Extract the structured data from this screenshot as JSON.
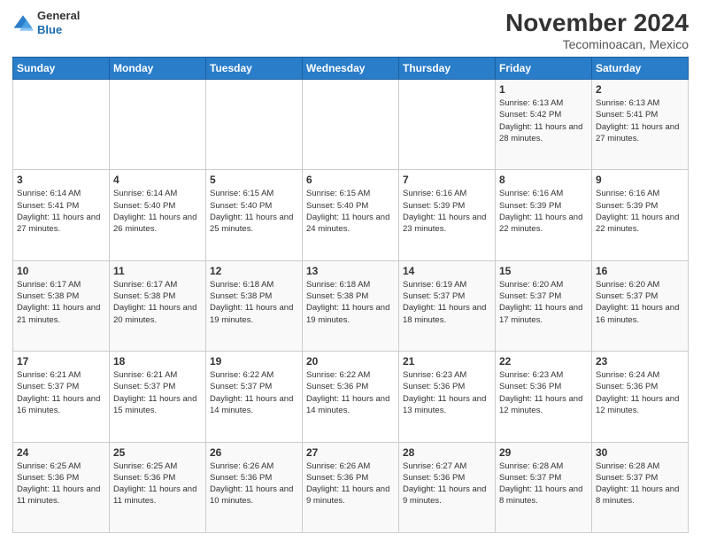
{
  "header": {
    "logo": {
      "general": "General",
      "blue": "Blue"
    },
    "month": "November 2024",
    "location": "Tecominoacan, Mexico"
  },
  "weekdays": [
    "Sunday",
    "Monday",
    "Tuesday",
    "Wednesday",
    "Thursday",
    "Friday",
    "Saturday"
  ],
  "weeks": [
    [
      {
        "date": "",
        "info": ""
      },
      {
        "date": "",
        "info": ""
      },
      {
        "date": "",
        "info": ""
      },
      {
        "date": "",
        "info": ""
      },
      {
        "date": "",
        "info": ""
      },
      {
        "date": "1",
        "info": "Sunrise: 6:13 AM\nSunset: 5:42 PM\nDaylight: 11 hours and 28 minutes."
      },
      {
        "date": "2",
        "info": "Sunrise: 6:13 AM\nSunset: 5:41 PM\nDaylight: 11 hours and 27 minutes."
      }
    ],
    [
      {
        "date": "3",
        "info": "Sunrise: 6:14 AM\nSunset: 5:41 PM\nDaylight: 11 hours and 27 minutes."
      },
      {
        "date": "4",
        "info": "Sunrise: 6:14 AM\nSunset: 5:40 PM\nDaylight: 11 hours and 26 minutes."
      },
      {
        "date": "5",
        "info": "Sunrise: 6:15 AM\nSunset: 5:40 PM\nDaylight: 11 hours and 25 minutes."
      },
      {
        "date": "6",
        "info": "Sunrise: 6:15 AM\nSunset: 5:40 PM\nDaylight: 11 hours and 24 minutes."
      },
      {
        "date": "7",
        "info": "Sunrise: 6:16 AM\nSunset: 5:39 PM\nDaylight: 11 hours and 23 minutes."
      },
      {
        "date": "8",
        "info": "Sunrise: 6:16 AM\nSunset: 5:39 PM\nDaylight: 11 hours and 22 minutes."
      },
      {
        "date": "9",
        "info": "Sunrise: 6:16 AM\nSunset: 5:39 PM\nDaylight: 11 hours and 22 minutes."
      }
    ],
    [
      {
        "date": "10",
        "info": "Sunrise: 6:17 AM\nSunset: 5:38 PM\nDaylight: 11 hours and 21 minutes."
      },
      {
        "date": "11",
        "info": "Sunrise: 6:17 AM\nSunset: 5:38 PM\nDaylight: 11 hours and 20 minutes."
      },
      {
        "date": "12",
        "info": "Sunrise: 6:18 AM\nSunset: 5:38 PM\nDaylight: 11 hours and 19 minutes."
      },
      {
        "date": "13",
        "info": "Sunrise: 6:18 AM\nSunset: 5:38 PM\nDaylight: 11 hours and 19 minutes."
      },
      {
        "date": "14",
        "info": "Sunrise: 6:19 AM\nSunset: 5:37 PM\nDaylight: 11 hours and 18 minutes."
      },
      {
        "date": "15",
        "info": "Sunrise: 6:20 AM\nSunset: 5:37 PM\nDaylight: 11 hours and 17 minutes."
      },
      {
        "date": "16",
        "info": "Sunrise: 6:20 AM\nSunset: 5:37 PM\nDaylight: 11 hours and 16 minutes."
      }
    ],
    [
      {
        "date": "17",
        "info": "Sunrise: 6:21 AM\nSunset: 5:37 PM\nDaylight: 11 hours and 16 minutes."
      },
      {
        "date": "18",
        "info": "Sunrise: 6:21 AM\nSunset: 5:37 PM\nDaylight: 11 hours and 15 minutes."
      },
      {
        "date": "19",
        "info": "Sunrise: 6:22 AM\nSunset: 5:37 PM\nDaylight: 11 hours and 14 minutes."
      },
      {
        "date": "20",
        "info": "Sunrise: 6:22 AM\nSunset: 5:36 PM\nDaylight: 11 hours and 14 minutes."
      },
      {
        "date": "21",
        "info": "Sunrise: 6:23 AM\nSunset: 5:36 PM\nDaylight: 11 hours and 13 minutes."
      },
      {
        "date": "22",
        "info": "Sunrise: 6:23 AM\nSunset: 5:36 PM\nDaylight: 11 hours and 12 minutes."
      },
      {
        "date": "23",
        "info": "Sunrise: 6:24 AM\nSunset: 5:36 PM\nDaylight: 11 hours and 12 minutes."
      }
    ],
    [
      {
        "date": "24",
        "info": "Sunrise: 6:25 AM\nSunset: 5:36 PM\nDaylight: 11 hours and 11 minutes."
      },
      {
        "date": "25",
        "info": "Sunrise: 6:25 AM\nSunset: 5:36 PM\nDaylight: 11 hours and 11 minutes."
      },
      {
        "date": "26",
        "info": "Sunrise: 6:26 AM\nSunset: 5:36 PM\nDaylight: 11 hours and 10 minutes."
      },
      {
        "date": "27",
        "info": "Sunrise: 6:26 AM\nSunset: 5:36 PM\nDaylight: 11 hours and 9 minutes."
      },
      {
        "date": "28",
        "info": "Sunrise: 6:27 AM\nSunset: 5:36 PM\nDaylight: 11 hours and 9 minutes."
      },
      {
        "date": "29",
        "info": "Sunrise: 6:28 AM\nSunset: 5:37 PM\nDaylight: 11 hours and 8 minutes."
      },
      {
        "date": "30",
        "info": "Sunrise: 6:28 AM\nSunset: 5:37 PM\nDaylight: 11 hours and 8 minutes."
      }
    ]
  ]
}
